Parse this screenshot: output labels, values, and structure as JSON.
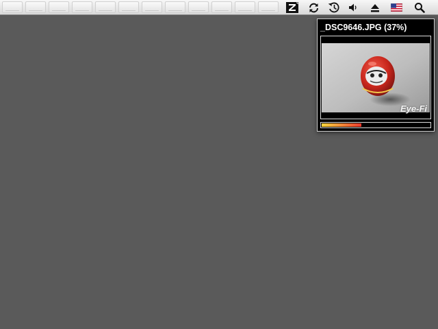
{
  "menubar": {
    "menu_slot_count": 12,
    "extras": [
      {
        "name": "eyefi-menu-icon",
        "icon": "eyefi-z"
      },
      {
        "name": "sync-icon",
        "icon": "sync-arrows"
      },
      {
        "name": "time-machine-icon",
        "icon": "clock-history"
      },
      {
        "name": "volume-icon",
        "icon": "speaker"
      },
      {
        "name": "eject-icon",
        "icon": "eject"
      },
      {
        "name": "input-source-flag-icon",
        "icon": "us-flag"
      },
      {
        "name": "spotlight-search-icon",
        "icon": "magnifier"
      }
    ]
  },
  "hud": {
    "title": "_DSC9646.JPG (37%)",
    "progress_percent": 37,
    "watermark": "Eye-Fi",
    "colors": {
      "progress_start": "#f4d43c",
      "progress_end": "#e9382c",
      "panel_bg": "#000000"
    }
  }
}
